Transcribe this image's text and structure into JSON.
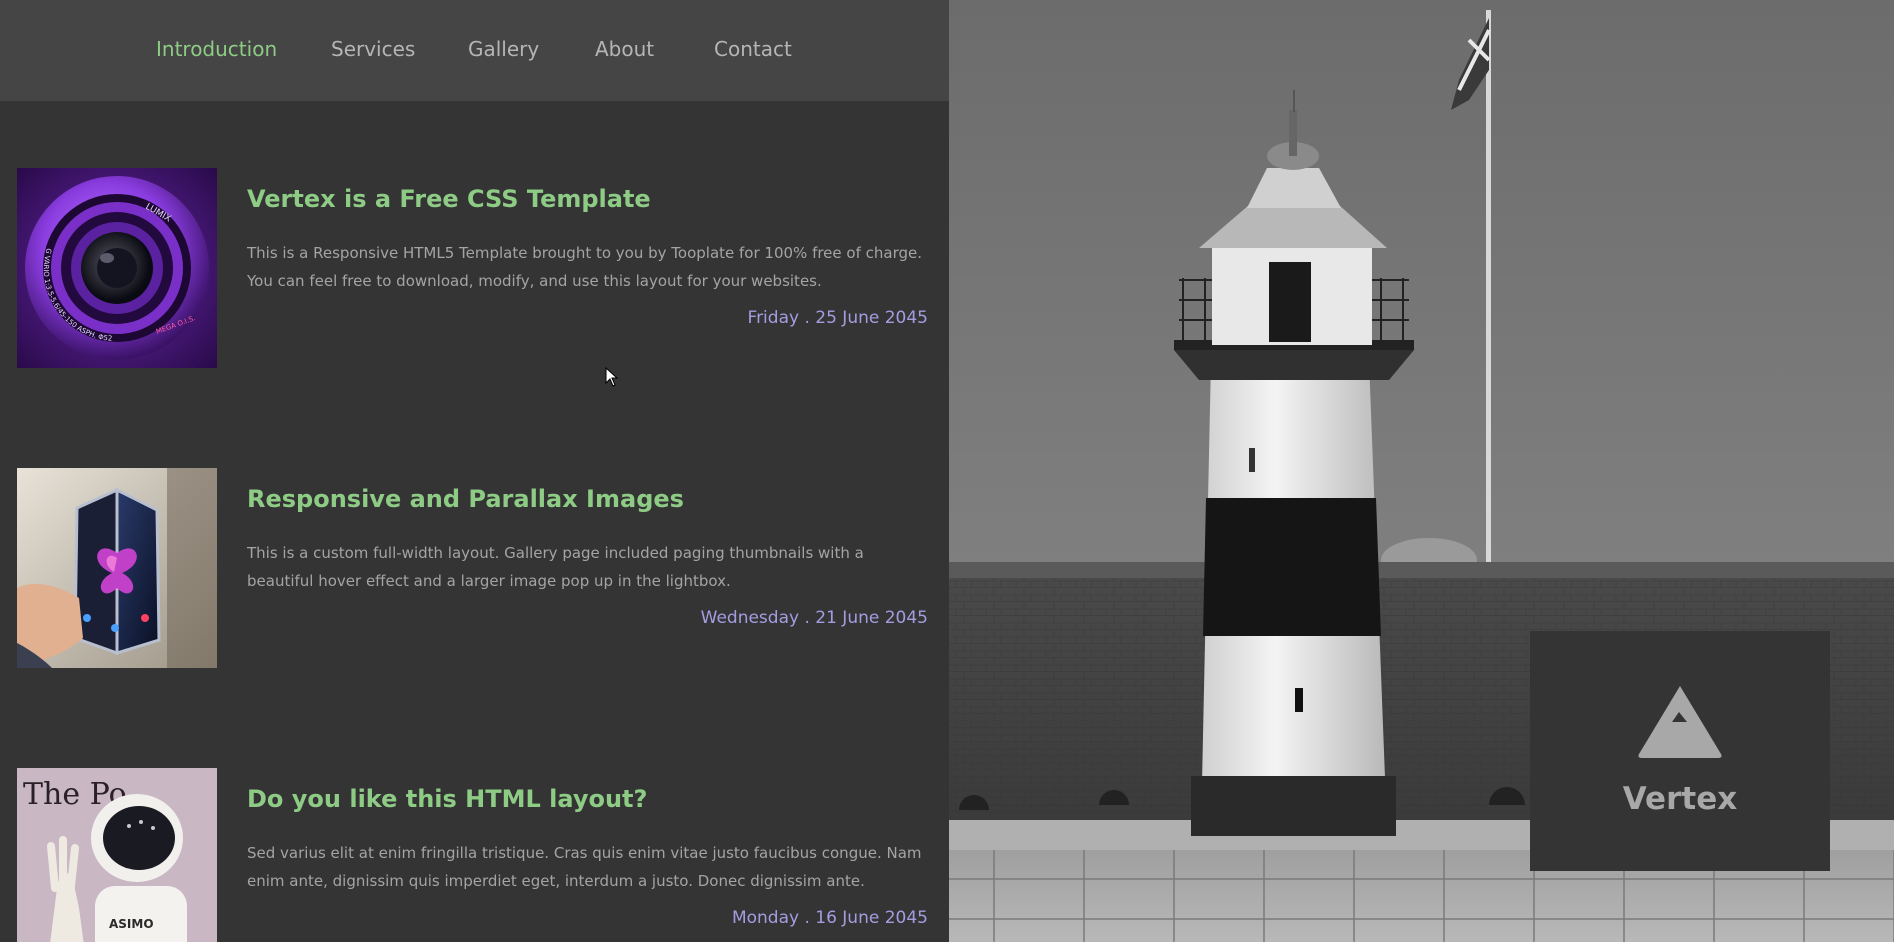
{
  "nav": {
    "items": [
      {
        "label": "Introduction",
        "active": true
      },
      {
        "label": "Services",
        "active": false
      },
      {
        "label": "Gallery",
        "active": false
      },
      {
        "label": "About",
        "active": false
      },
      {
        "label": "Contact",
        "active": false
      }
    ]
  },
  "posts": [
    {
      "title": "Vertex is a Free CSS Template",
      "body": "This is a Responsive HTML5 Template brought to you by Tooplate for 100% free of charge. You can feel free to download, modify, and use this layout for your websites.",
      "date": "Friday . 25 June 2045",
      "image": "camera-lens-photo"
    },
    {
      "title": "Responsive and Parallax Images",
      "body": "This is a custom full-width layout. Gallery page included paging thumbnails with a beautiful hover effect and a larger image pop up in the lightbox.",
      "date": "Wednesday . 21 June 2045",
      "image": "foldable-phone-photo"
    },
    {
      "title": "Do you like this HTML layout?",
      "body": "Sed varius elit at enim fringilla tristique. Cras quis enim vitae justo faucibus congue. Nam enim ante, dignissim quis imperdiet eget, interdum a justo. Donec dignissim ante.",
      "date": "Monday . 16 June 2045",
      "image": "asimo-robot-photo",
      "image_text": {
        "sign": "The Po",
        "robot_label": "ASIMO"
      }
    }
  ],
  "lens_text": {
    "brand": "LUMIX",
    "ring": "G VARIO 1:3.5-5.6/45-150 ASPH. Φ52",
    "mega": "MEGA O.I.S."
  },
  "brand": {
    "name": "Vertex",
    "logo_icon": "triangle-logo-icon"
  },
  "hero_image": "lighthouse-photo",
  "colors": {
    "accent_green": "#8ecc86",
    "date_purple": "#a39de0",
    "panel_bg": "#343434",
    "nav_bg": "#454545"
  }
}
